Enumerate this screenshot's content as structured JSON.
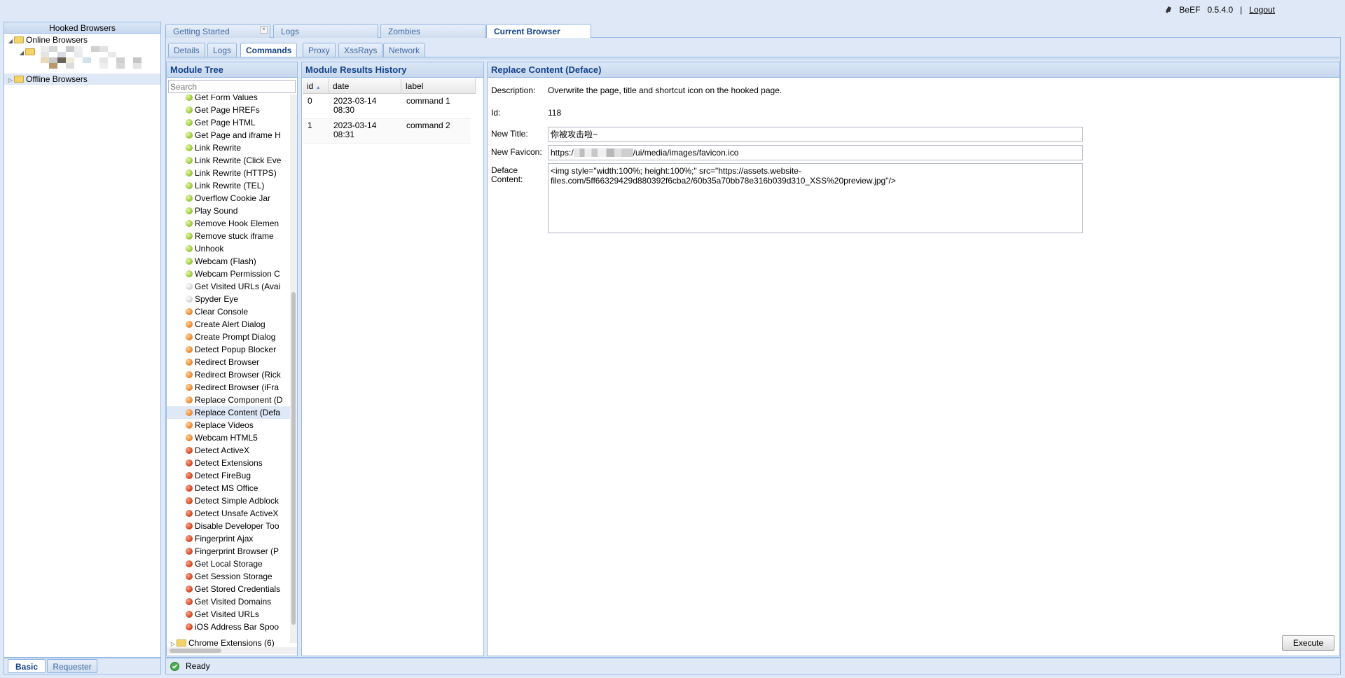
{
  "header": {
    "app_name": "BeEF",
    "version": "0.5.4.0",
    "separator": "|",
    "logout": "Logout"
  },
  "left_panel": {
    "title": "Hooked Browsers",
    "online_label": "Online Browsers",
    "offline_label": "Offline Browsers",
    "bottom_tabs": [
      "Basic",
      "Requester"
    ]
  },
  "main_tabs": [
    {
      "label": "Getting Started"
    },
    {
      "label": "Logs"
    },
    {
      "label": "Zombies"
    },
    {
      "label": "Current Browser"
    }
  ],
  "sub_tabs": [
    "Details",
    "Logs",
    "Commands",
    "Proxy",
    "XssRays",
    "Network"
  ],
  "module_tree": {
    "title": "Module Tree",
    "search_placeholder": "Search",
    "modules": [
      {
        "label": "Get Form Values",
        "status": "green"
      },
      {
        "label": "Get Page HREFs",
        "status": "green"
      },
      {
        "label": "Get Page HTML",
        "status": "green"
      },
      {
        "label": "Get Page and iframe H",
        "status": "green"
      },
      {
        "label": "Link Rewrite",
        "status": "green"
      },
      {
        "label": "Link Rewrite (Click Eve",
        "status": "green"
      },
      {
        "label": "Link Rewrite (HTTPS)",
        "status": "green"
      },
      {
        "label": "Link Rewrite (TEL)",
        "status": "green"
      },
      {
        "label": "Overflow Cookie Jar",
        "status": "green"
      },
      {
        "label": "Play Sound",
        "status": "green"
      },
      {
        "label": "Remove Hook Elemen",
        "status": "green"
      },
      {
        "label": "Remove stuck iframe",
        "status": "green"
      },
      {
        "label": "Unhook",
        "status": "green"
      },
      {
        "label": "Webcam (Flash)",
        "status": "green"
      },
      {
        "label": "Webcam Permission C",
        "status": "green"
      },
      {
        "label": "Get Visited URLs (Avai",
        "status": "grey"
      },
      {
        "label": "Spyder Eye",
        "status": "grey"
      },
      {
        "label": "Clear Console",
        "status": "orange"
      },
      {
        "label": "Create Alert Dialog",
        "status": "orange"
      },
      {
        "label": "Create Prompt Dialog",
        "status": "orange"
      },
      {
        "label": "Detect Popup Blocker",
        "status": "orange"
      },
      {
        "label": "Redirect Browser",
        "status": "orange"
      },
      {
        "label": "Redirect Browser (Rick",
        "status": "orange"
      },
      {
        "label": "Redirect Browser (iFra",
        "status": "orange"
      },
      {
        "label": "Replace Component (D",
        "status": "orange"
      },
      {
        "label": "Replace Content (Defa",
        "status": "orange",
        "selected": true
      },
      {
        "label": "Replace Videos",
        "status": "orange"
      },
      {
        "label": "Webcam HTML5",
        "status": "orange"
      },
      {
        "label": "Detect ActiveX",
        "status": "red"
      },
      {
        "label": "Detect Extensions",
        "status": "red"
      },
      {
        "label": "Detect FireBug",
        "status": "red"
      },
      {
        "label": "Detect MS Office",
        "status": "red"
      },
      {
        "label": "Detect Simple Adblock",
        "status": "red"
      },
      {
        "label": "Detect Unsafe ActiveX",
        "status": "red"
      },
      {
        "label": "Disable Developer Too",
        "status": "red"
      },
      {
        "label": "Fingerprint Ajax",
        "status": "red"
      },
      {
        "label": "Fingerprint Browser (P",
        "status": "red"
      },
      {
        "label": "Get Local Storage",
        "status": "red"
      },
      {
        "label": "Get Session Storage",
        "status": "red"
      },
      {
        "label": "Get Stored Credentials",
        "status": "red"
      },
      {
        "label": "Get Visited Domains",
        "status": "red"
      },
      {
        "label": "Get Visited URLs",
        "status": "red"
      },
      {
        "label": "iOS Address Bar Spoo",
        "status": "red"
      }
    ],
    "folder_label": "Chrome Extensions (6)"
  },
  "results": {
    "title": "Module Results History",
    "columns": [
      "id",
      "date",
      "label"
    ],
    "rows": [
      {
        "id": "0",
        "date_line1": "2023-03-14",
        "date_line2": "08:30",
        "label": "command 1"
      },
      {
        "id": "1",
        "date_line1": "2023-03-14",
        "date_line2": "08:31",
        "label": "command 2"
      }
    ]
  },
  "detail": {
    "title": "Replace Content (Deface)",
    "description_label": "Description:",
    "description": "Overwrite the page, title and shortcut icon on the hooked page.",
    "id_label": "Id:",
    "id": "118",
    "new_title_label": "New Title:",
    "new_title": "你被攻击啦~",
    "new_favicon_label": "New Favicon:",
    "favicon_prefix": "https:/",
    "favicon_suffix": "/ui/media/images/favicon.ico",
    "deface_label_1": "Deface",
    "deface_label_2": "Content:",
    "deface_content_line1": "<img style=\"width:100%; height:100%;\" src=\"https://assets.website-",
    "deface_content_line2": "files.com/5ff66329429d880392f6cba2/60b35a70bb78e316b039d310_XSS%20preview.jpg\"/>",
    "execute_label": "Execute"
  },
  "status_bar": {
    "text": "Ready"
  },
  "colors": {
    "accent": "#15428b",
    "border": "#99bbe8",
    "background": "#dfe8f6"
  }
}
